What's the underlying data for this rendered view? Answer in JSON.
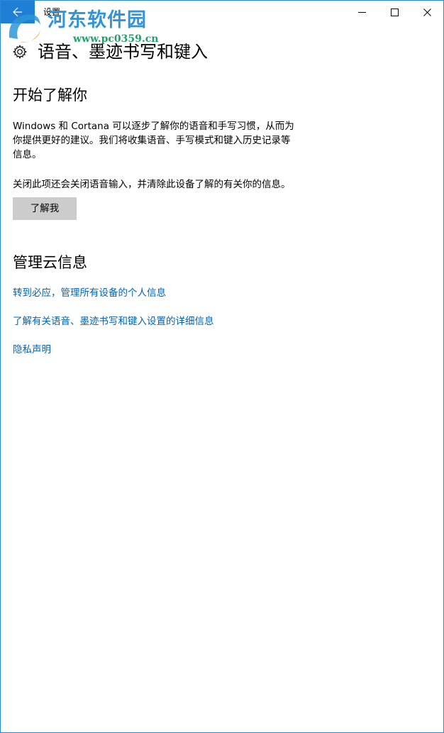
{
  "window": {
    "title": "设置",
    "accent": "#1f7fd6",
    "border_color": "#2b88d8",
    "back_icon": "arrow-left-icon",
    "controls": [
      "minimize-icon",
      "maximize-icon",
      "close-icon"
    ]
  },
  "watermark": {
    "text": "河东软件园",
    "url": "www.pc0359.cn"
  },
  "page": {
    "title": "语音、墨迹书写和键入",
    "icon": "gear-icon"
  },
  "sections": {
    "getting_to_know": {
      "title": "开始了解你",
      "description_line1": "Windows 和 Cortana 可以逐步了解你的语音和手写习惯，从而为",
      "description_line2": "你提供更好的建议。我们将收集语音、手写模式和键入历史记录等",
      "description_line3": "信息。",
      "note": "关闭此项还会关闭语音输入，并清除此设备了解的有关你的信息。",
      "button_label": "了解我"
    },
    "cloud": {
      "title": "管理云信息",
      "links": [
        "转到必应，管理所有设备的个人信息",
        "了解有关语音、墨迹书写和键入设置的详细信息",
        "隐私声明"
      ]
    }
  },
  "colors": {
    "link": "#0063b1",
    "button_bg": "#cccccc"
  }
}
